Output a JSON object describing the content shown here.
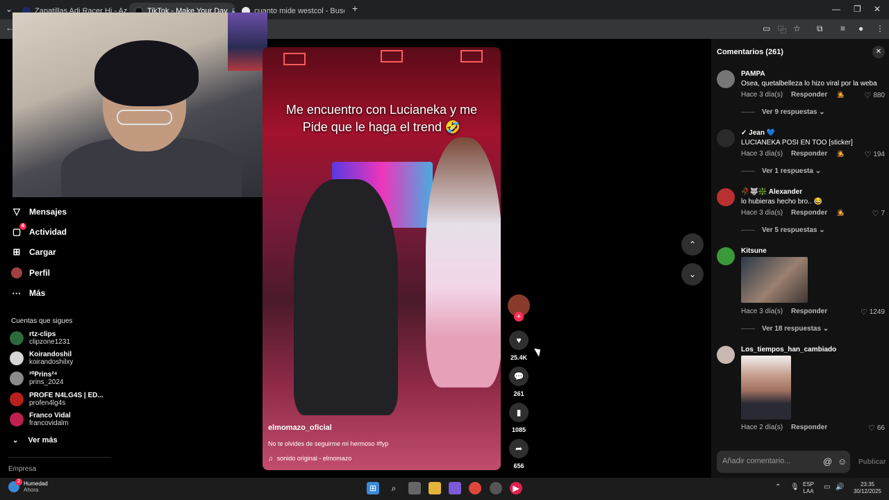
{
  "browser": {
    "tabs": [
      {
        "title": "Zapatillas Adi Racer Hi - Azul a",
        "favicon_color": "#1e2a6a",
        "active": false
      },
      {
        "title": "TikTok - Make Your Day",
        "favicon_color": "#111111",
        "active": true
      },
      {
        "title": "cuanto mide westcol - Buscar c",
        "favicon_color": "#e9e9e9",
        "active": false
      }
    ],
    "new_tab_icon": "plus-icon"
  },
  "sidebar": {
    "items": [
      {
        "label": "Mensajes",
        "icon": "send-icon"
      },
      {
        "label": "Actividad",
        "icon": "inbox-icon",
        "badge": "6"
      },
      {
        "label": "Cargar",
        "icon": "upload-icon"
      },
      {
        "label": "Perfil",
        "icon": "avatar"
      },
      {
        "label": "Más",
        "icon": "more-icon"
      }
    ],
    "following_title": "Cuentas que sigues",
    "following": [
      {
        "name": "rtz-clips",
        "handle": "clipzone1231",
        "color": "#2c6a3a"
      },
      {
        "name": "Koirandoshil",
        "handle": "koirandoshilxy",
        "color": "#d6d6d6"
      },
      {
        "name": "²⁰Prins²⁴",
        "handle": "prins_2024",
        "color": "#8a8a8a"
      },
      {
        "name": "PROFE N4LG4S | ED...",
        "handle": "profen4lg4s",
        "color": "#b8201e"
      },
      {
        "name": "Franco Vidal",
        "handle": "francovidalm",
        "color": "#c02050"
      }
    ],
    "see_more": "Ver más",
    "footer": "Empresa"
  },
  "video": {
    "caption_line1": "Me encuentro con Lucianeka y me",
    "caption_line2": "Pide que le haga el trend 🤣",
    "author": "elmomazo_oficial",
    "description": "No te olvides de seguirme mi hermoso #fyp",
    "sound": "sonido original - elmomazo",
    "likes": "25.4K",
    "comments": "261",
    "saves": "1085",
    "shares": "656"
  },
  "comments": {
    "title": "Comentarios (261)",
    "items": [
      {
        "user": "PAMPA",
        "text": "Osea, quetalbelleza lo hizo viral por la weba",
        "time": "Hace 3 día(s)",
        "reply": "Responder",
        "likes": "880",
        "view": "Ver 9 respuestas",
        "color": "#777777"
      },
      {
        "user": "✓ Jean 💙",
        "text": "LUCIANEKA POSI EN TOO [sticker]",
        "time": "Hace 3 día(s)",
        "reply": "Responder",
        "likes": "194",
        "view": "Ver 1 respuesta",
        "color": "#2a2a2a"
      },
      {
        "user": "🥀🐺❇️ Alexander",
        "text": "lo hubieras hecho bro.. 😂",
        "time": "Hace 3 día(s)",
        "reply": "Responder",
        "likes": "7",
        "view": "Ver 5 respuestas",
        "color": "#b83030"
      },
      {
        "user": "Kitsune",
        "text": "",
        "time": "Hace 3 día(s)",
        "reply": "Responder",
        "likes": "1249",
        "view": "Ver 18 respuestas",
        "color": "#3a9a3a"
      },
      {
        "user": "Los_tiempos_han_cambiado",
        "text": "",
        "time": "Hace 2 día(s)",
        "reply": "Responder",
        "likes": "66",
        "view": "",
        "color": "#c8b8b0"
      }
    ],
    "input_placeholder": "Añadir comentario...",
    "publish": "Publicar"
  },
  "taskbar": {
    "weather_badge": "2",
    "weather_title": "Humedad",
    "weather_sub": "Ahora",
    "lang_1": "ESP",
    "lang_2": "LAA",
    "time": "23:35",
    "date": "30/12/2025"
  }
}
